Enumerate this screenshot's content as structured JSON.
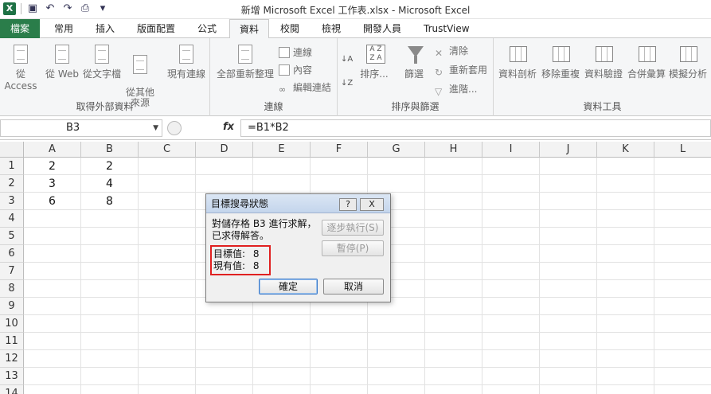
{
  "window": {
    "title": "新增 Microsoft Excel 工作表.xlsx - Microsoft Excel",
    "quick_access": {
      "app_icon": "X"
    }
  },
  "menu": {
    "tabs": [
      {
        "label": "檔案",
        "kind": "file"
      },
      {
        "label": "常用"
      },
      {
        "label": "插入"
      },
      {
        "label": "版面配置"
      },
      {
        "label": "公式"
      },
      {
        "label": "資料",
        "active": true
      },
      {
        "label": "校閱"
      },
      {
        "label": "檢視"
      },
      {
        "label": "開發人員"
      },
      {
        "label": "TrustView"
      }
    ]
  },
  "ribbon": {
    "groups": {
      "external": {
        "label": "取得外部資料",
        "buttons": [
          "從 Access",
          "從 Web",
          "從文字檔",
          "從其他\n來源",
          "現有連線"
        ]
      },
      "connections": {
        "label": "連線",
        "big_button": "全部重新整理",
        "small": [
          "連線",
          "內容",
          "編輯連結"
        ]
      },
      "sort_filter": {
        "label": "排序與篩選",
        "big": [
          "排序...",
          "篩選"
        ],
        "small": [
          "清除",
          "重新套用",
          "進階..."
        ]
      },
      "data_tools": {
        "label": "資料工具",
        "buttons": [
          "資料剖析",
          "移除重複",
          "資料驗證",
          "合併彙算",
          "模擬分析"
        ]
      }
    }
  },
  "formula_bar": {
    "name_box": "B3",
    "fx_label": "fx",
    "formula": "=B1*B2"
  },
  "sheet": {
    "columns": [
      "A",
      "B",
      "C",
      "D",
      "E",
      "F",
      "G",
      "H",
      "I",
      "J",
      "K",
      "L"
    ],
    "rows": [
      "1",
      "2",
      "3",
      "4",
      "5",
      "6",
      "7",
      "8",
      "9",
      "10",
      "11",
      "12",
      "13",
      "14"
    ],
    "cells": [
      {
        "ref": "A1",
        "value": "2"
      },
      {
        "ref": "B1",
        "value": "2"
      },
      {
        "ref": "A2",
        "value": "3"
      },
      {
        "ref": "B2",
        "value": "4"
      },
      {
        "ref": "A3",
        "value": "6"
      },
      {
        "ref": "B3",
        "value": "8"
      }
    ]
  },
  "dialog": {
    "title": "目標搜尋狀態",
    "help_label": "?",
    "close_label": "X",
    "message_line1": "對儲存格 B3 進行求解，",
    "message_line2": "已求得解答。",
    "target_label": "目標值:",
    "target_value": "8",
    "current_label": "現有值:",
    "current_value": "8",
    "step_button": "逐步執行(S)",
    "pause_button": "暫停(P)",
    "ok_button": "確定",
    "cancel_button": "取消"
  }
}
